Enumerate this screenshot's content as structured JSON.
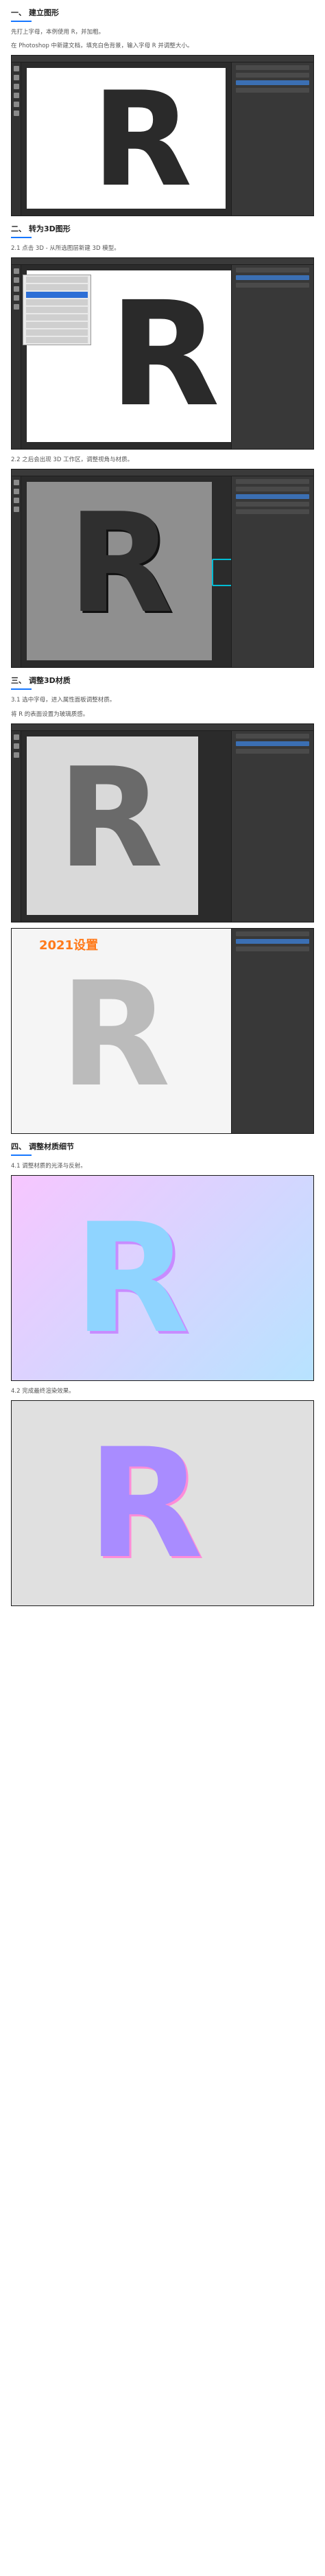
{
  "sections": [
    {
      "number": "一、",
      "title": "建立图形",
      "paragraphs": [
        "先打上字母，本例使用 R，并加粗。",
        "在 Photoshop 中新建文档，填充白色背景，输入字母 R 并调整大小。"
      ]
    },
    {
      "number": "二、",
      "title": "转为3D图形",
      "paragraphs": [
        "2.1 点击 3D - 从所选图层新建 3D 模型。",
        "2.2 之后会出现 3D 工作区，调整视角与材质。"
      ]
    },
    {
      "number": "三、",
      "title": "调整3D材质",
      "paragraphs": [
        "3.1 选中字母，进入属性面板调整材质。",
        "将 R 的表面设置为玻璃质感。"
      ],
      "year_tag": "2021设置"
    },
    {
      "number": "四、",
      "title": "调整材质细节",
      "paragraphs": [
        "4.1 调整材质的光泽与反射。",
        "4.2 完成最终渲染效果。"
      ]
    }
  ],
  "letter": "R",
  "colors": {
    "accent": "#1677ff",
    "highlight": "#ff7a1a",
    "ps_bg": "#2b2b2b"
  }
}
